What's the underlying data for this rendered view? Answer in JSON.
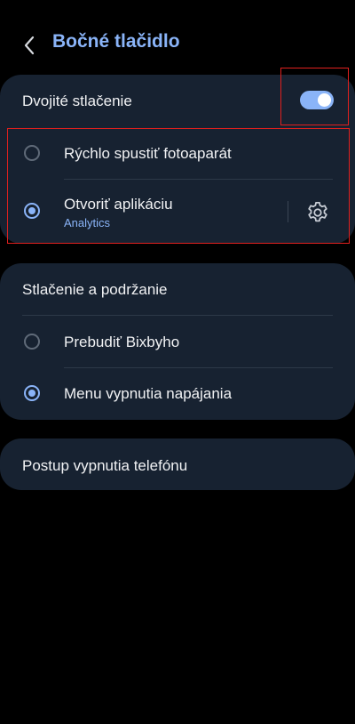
{
  "header": {
    "title": "Bočné tlačidlo",
    "back_icon": "chevron-left-icon"
  },
  "double_press": {
    "label": "Dvojité stlačenie",
    "toggle_on": true,
    "options": [
      {
        "label": "Rýchlo spustiť fotoaparát",
        "selected": false
      },
      {
        "label": "Otvoriť aplikáciu",
        "sublabel": "Analytics",
        "selected": true,
        "settings_icon": "gear-icon"
      }
    ]
  },
  "press_hold": {
    "label": "Stlačenie a podržanie",
    "options": [
      {
        "label": "Prebudiť Bixbyho",
        "selected": false
      },
      {
        "label": "Menu vypnutia napájania",
        "selected": true
      }
    ]
  },
  "power_off": {
    "label": "Postup vypnutia telefónu"
  },
  "colors": {
    "background": "#000000",
    "card": "#172231",
    "accent": "#8ab4f8",
    "highlight": "#e0201e"
  }
}
